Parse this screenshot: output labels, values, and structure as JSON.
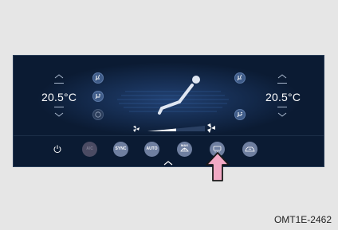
{
  "climate": {
    "left_temp": "20.5°C",
    "right_temp": "20.5°C",
    "buttons": {
      "ac": "A/C",
      "sync": "SYNC",
      "auto": "AUTO",
      "max": "MAX"
    }
  },
  "caption": "OMT1E-2462",
  "colors": {
    "panel": "#0b1b33",
    "button": "#6f7fa0",
    "arrow": "#f2a9c4"
  }
}
